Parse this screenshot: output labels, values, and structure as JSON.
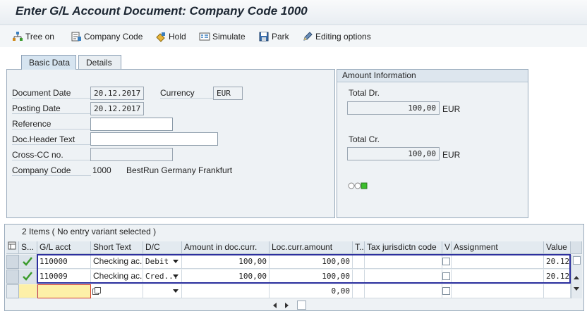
{
  "window": {
    "title": "Enter G/L Account Document: Company Code 1000"
  },
  "toolbar": {
    "tree_on": "Tree on",
    "company_code": "Company Code",
    "hold": "Hold",
    "simulate": "Simulate",
    "park": "Park",
    "editing_options": "Editing options"
  },
  "tabs": {
    "basic_data": "Basic Data",
    "details": "Details"
  },
  "basic": {
    "document_date_label": "Document Date",
    "document_date": "20.12.2017",
    "currency_label": "Currency",
    "currency": "EUR",
    "posting_date_label": "Posting Date",
    "posting_date": "20.12.2017",
    "reference_label": "Reference",
    "reference": "",
    "doc_header_label": "Doc.Header Text",
    "doc_header": "",
    "cross_cc_label": "Cross-CC no.",
    "cross_cc": "",
    "company_code_label": "Company Code",
    "company_code": "1000",
    "company_name": "BestRun Germany Frankfurt"
  },
  "amount_info": {
    "header": "Amount Information",
    "total_dr_label": "Total Dr.",
    "total_dr": "100,00",
    "total_dr_cur": "EUR",
    "total_cr_label": "Total Cr.",
    "total_cr": "100,00",
    "total_cr_cur": "EUR"
  },
  "grid": {
    "title": "2 Items ( No entry variant selected )",
    "headers": {
      "status": "S...",
      "gl_acct": "G/L acct",
      "short_text": "Short Text",
      "dc": "D/C",
      "amount_doc": "Amount in doc.curr.",
      "amount_loc": "Loc.curr.amount",
      "t": "T..",
      "tax": "Tax jurisdictn code",
      "v": "V",
      "assignment": "Assignment",
      "value": "Value"
    },
    "rows": [
      {
        "gl_acct": "110000",
        "short_text": "Checking ac...",
        "dc": "Debit",
        "amount_doc": "100,00",
        "amount_loc": "100,00",
        "value": "20.12"
      },
      {
        "gl_acct": "110009",
        "short_text": "Checking ac...",
        "dc": "Cred...",
        "amount_doc": "100,00",
        "amount_loc": "100,00",
        "value": "20.12"
      }
    ],
    "blank_row": {
      "amount_loc": "0,00"
    }
  },
  "colors": {
    "accent": "#2c2f9e",
    "status_ok": "#3b9b2c",
    "input_required": "#fdf0a8"
  }
}
